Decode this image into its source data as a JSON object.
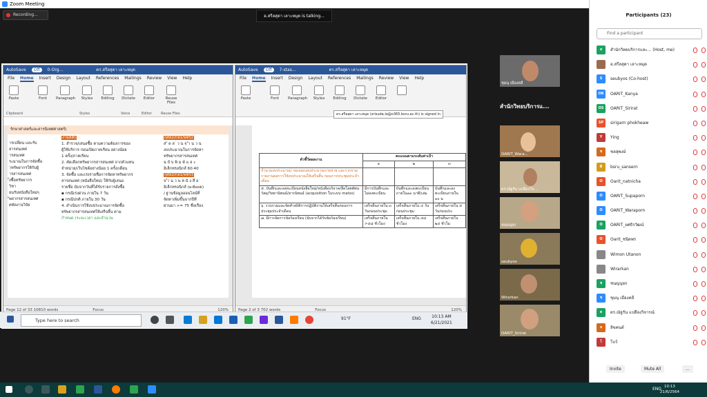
{
  "zoom": {
    "title": "Zoom Meeting",
    "recording": "Recording...",
    "talking": "อ.สรีลสุดา เลาะหมุด is  talking..."
  },
  "left_doc": {
    "autosave": "AutoSave",
    "off": "Off",
    "filename": "0-Org...",
    "user": "ดร.สรีลสุดา เลาะหมุด",
    "tabs": [
      "File",
      "Home",
      "Insert",
      "Design",
      "Layout",
      "References",
      "Mailings",
      "Review",
      "View",
      "Help"
    ],
    "buttons": [
      "Paste",
      "Font",
      "Paragraph",
      "Styles",
      "Editing",
      "Dictate",
      "Editor",
      "Reuse Files"
    ],
    "groups": [
      "Clipboard",
      "Styles",
      "Voice",
      "Editor",
      "Reuse Files"
    ],
    "header": "รักษาศาสตร์และสารนิเทศศาสตร์)",
    "col1": [
      "ารเปลี่ยน และรับ",
      "สารสนเทศ",
      "ารสนเทศ",
      "ระมาณในการจัดซื้อ",
      "าทรัพยากรให้กับผู้",
      "ารสารสนเทศ",
      "ั่งซื้อทรัพยากร",
      "วิชา",
      "ยนรับหนังสือใหม่ๆ",
      "ัพยากรสารสนเทศ",
      "ตหัดงานวิจัย"
    ],
    "col2_head": "งานหลัก",
    "col2": [
      "1. สำรวจ/เสนอซื้อ ตามความต้องการของ",
      "ผู้ใช้บริการ ก่อนเปิดภาคเรียน อย่างน้อย",
      "1 ครั้ง/ภาคเรียน",
      "2. คัดเลือกทรัพยากรสารสนเทศ จากตัวแทน",
      "จำหน่าย/เว็บไซต์อย่างน้อย 1 ครั้ง/เดือน",
      "3. จัดซื้อ และเร่งรายชื่อการจัดหาทรัพยากร",
      "สารสนเทศ (หนังสือใหม่) ให้กับผู้เสนอ",
      "รายชื่อ นับจากวันที่ได้รับรายการสั่งซื้อ",
      "▪ กรณีเร่งด่วน ภายใน 7 วัน",
      "▪ กรณีปกติ ภายใน 30 วัน",
      "4. ดำเนินการใช้งบประมาณการจัดซื้อ",
      "ทรัพยากรสารสนเทศให้เสร็จสิ้น ตาม",
      "กำหนด (ระยะเวลา และจำนวน"
    ],
    "col3_head": "กุศล2/กล1/พชร2",
    "col3": [
      "ส ั ด ส ่ ว น จ ำ น ว น",
      "งบประมาณในการจัดหา",
      "ทรัพยากรสารสนเทศ",
      "ฉ บั บ พิ ม พ์ แ ล ะ",
      "อิเล็กทรอนิกส์  60:40"
    ],
    "col3_head2": "กุศล2/กล1/พชร3",
    "col3b": [
      "จ ำ น ว น ห นั ง สื อ",
      "อิเล็กทรอนิกส์ (e-Book)",
      "/ ฐานข้อมูลออนไลน์ที่",
      "จัดหาเพิ่มขึ้นจากปีที่",
      "ผ่านมา >= 75 ชื่อเรื่อง"
    ],
    "status": "Page 12 of 33    10810 words",
    "focus": "Focus",
    "zoom": "120%"
  },
  "right_doc": {
    "autosave": "AutoSave",
    "off": "Off",
    "filename": "7-stas...",
    "user": "ดร.สรีลสุดา เลาะหมุด",
    "signin": "ดร.สรีลสุดา เลาะหมุด (srisuda.la@o365.bsru.ac.th) is signed in",
    "th_index": "ตัวชี้วัดผลงาน",
    "th_score": "คะแนนตามระดับค่าเป้า",
    "th_cols": [
      "๑",
      "๒",
      "๓"
    ],
    "rows": [
      {
        "c": "จำนวนงบประมาณ) ของแผนงบประมาณรายจ่าย และรวบรวมรายงานผลการใช้งบประมาณให้เสร็จสิ้น ก่อนการประชุมประจำเดือน",
        "v": [
          "",
          "",
          ""
        ]
      },
      {
        "c": "๕. บันทึกและลงทะเบียนหนังสือใหม่/หนังสือบริจาค/สื่อโสตทัศนวัสดุ/วิทยานิพนธ์/สารนิพนธ์ (acquisition ในระบบ matss)",
        "v": [
          "มีการบันทึกและไม่ลงทะเบียน",
          "บันทึกและลงทะเบียนภายใน๑๓ นาที/เล่ม",
          "บันทึกและลงทะเบียนภายใน ๑๐ น"
        ]
      },
      {
        "c": "๖. รวบรวมและจัดทำสถิติการปฏิบัติงานให้เสร็จสิ้นก่อนการประชุมประจำเดือน",
        "v": [
          "เสร็จสิ้นภายใน ๓ วันก่อนประชุม",
          "เสร็จสิ้นภายใน ๔ วันก่อนประชุม",
          "เสร็จสิ้นภายใน ๕ วันก่อนประ"
        ]
      },
      {
        "c": "๗. มีการจัดการข้อร้องเรียน (นับจากได้รับข้อร้องเรียน)",
        "v": [
          "เสร็จสิ้นภายใน >๔๘ ชั่วโมง",
          "เสร็จสิ้นภายใน ๔๘ ชั่วโมง",
          "เสร็จสิ้นภายใน ๒๔ ชั่วโม"
        ]
      }
    ],
    "status": "Page 2 of 3    702 words",
    "focus": "Focus",
    "zoom": "120%"
  },
  "taskbar": {
    "search": "Type here to search",
    "temp": "91°F",
    "lang": "ENG",
    "time": "10:13 AM",
    "date": "6/21/2021"
  },
  "participants": {
    "title": "Participants (23)",
    "search": "Find a participant",
    "list": [
      {
        "name": "สำนักวิทยบริการและ... (Host, me)",
        "av": "ส",
        "color": "#1aa260"
      },
      {
        "name": "อ.สรีลสุดา เลาะหมุด",
        "av": "",
        "color": "#9a6b4f"
      },
      {
        "name": "seubyos (Co-host)",
        "av": "S",
        "color": "#2d8cff"
      },
      {
        "name": "OARIT_Kanya",
        "av": "OK",
        "color": "#2d8cff"
      },
      {
        "name": "OARIT_Sirirat",
        "av": "OS",
        "color": "#1aa260"
      },
      {
        "name": "sirigarn phokheaw",
        "av": "SP",
        "color": "#e8532b"
      },
      {
        "name": "Ying",
        "av": "Y",
        "color": "#c23a3a"
      },
      {
        "name": "ชลสุพงษ์",
        "av": "ช",
        "color": "#d6691d"
      },
      {
        "name": "bsru_sansern",
        "av": "B",
        "color": "#d69b1d"
      },
      {
        "name": "Oarit_natnicha",
        "av": "O",
        "color": "#e8532b"
      },
      {
        "name": "OARIT_Supaporn",
        "av": "O",
        "color": "#2d8cff"
      },
      {
        "name": "OARIT_Waraporn",
        "av": "O",
        "color": "#2d8cff"
      },
      {
        "name": "OARIT_ยศธิรวัฒน์",
        "av": "O",
        "color": "#1aa260"
      },
      {
        "name": "Oarit_ชนิดพร",
        "av": "O",
        "color": "#e8532b"
      },
      {
        "name": "Wimon Utanon",
        "av": "",
        "color": "#888"
      },
      {
        "name": "Wirarkan",
        "av": "",
        "color": "#888"
      },
      {
        "name": "ชนญนุยก",
        "av": "ช",
        "color": "#1aa260"
      },
      {
        "name": "ชุมนุ เมืองคลี",
        "av": "ช",
        "color": "#2d8cff"
      },
      {
        "name": "ดร.ณัฐรัน แปลืองวิจารณ์",
        "av": "ด",
        "color": "#1aa260"
      },
      {
        "name": "ลิขคนต์",
        "av": "ล",
        "color": "#d6691d"
      },
      {
        "name": "โบว์",
        "av": "โ",
        "color": "#c23a3a"
      }
    ],
    "invite": "Invite",
    "muteall": "Mute All",
    "more": "..."
  },
  "videos": [
    {
      "name": "ชุมนุ เมืองคลี"
    },
    {
      "name": "สำนักวิทยบริการแ..."
    },
    {
      "name": "OARIT_Wara..."
    },
    {
      "name": "ดร.ณัฐรัน แปลืองวิจ..."
    },
    {
      "name": "ชนดนุยก"
    },
    {
      "name": "seubyos"
    },
    {
      "name": "Wirarkan"
    },
    {
      "name": "OARIT_Sirirat"
    }
  ],
  "wintaskbar": {
    "time": "10:13",
    "date": "21/6/2564",
    "lang": "ENG"
  }
}
